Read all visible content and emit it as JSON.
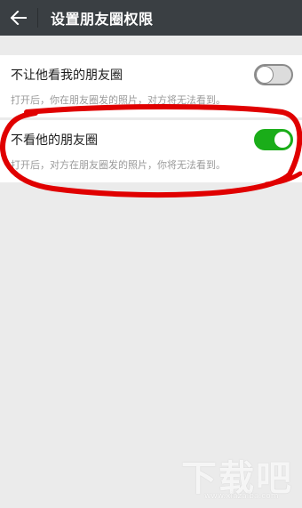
{
  "header": {
    "title": "设置朋友圈权限",
    "back_icon": "arrow-left-icon"
  },
  "settings": [
    {
      "label": "不让他看我的朋友圈",
      "description": "打开后，你在朋友圈发的照片，对方将无法看到。",
      "enabled": false
    },
    {
      "label": "不看他的朋友圈",
      "description": "打开后，对方在朋友圈发的照片，你将无法看到。",
      "enabled": true
    }
  ],
  "watermark": {
    "text": "下载吧",
    "url": "www.xiazaiba.com"
  },
  "colors": {
    "header_bg": "#3a3f43",
    "toggle_on": "#1aad19",
    "annotation": "#e00000"
  }
}
